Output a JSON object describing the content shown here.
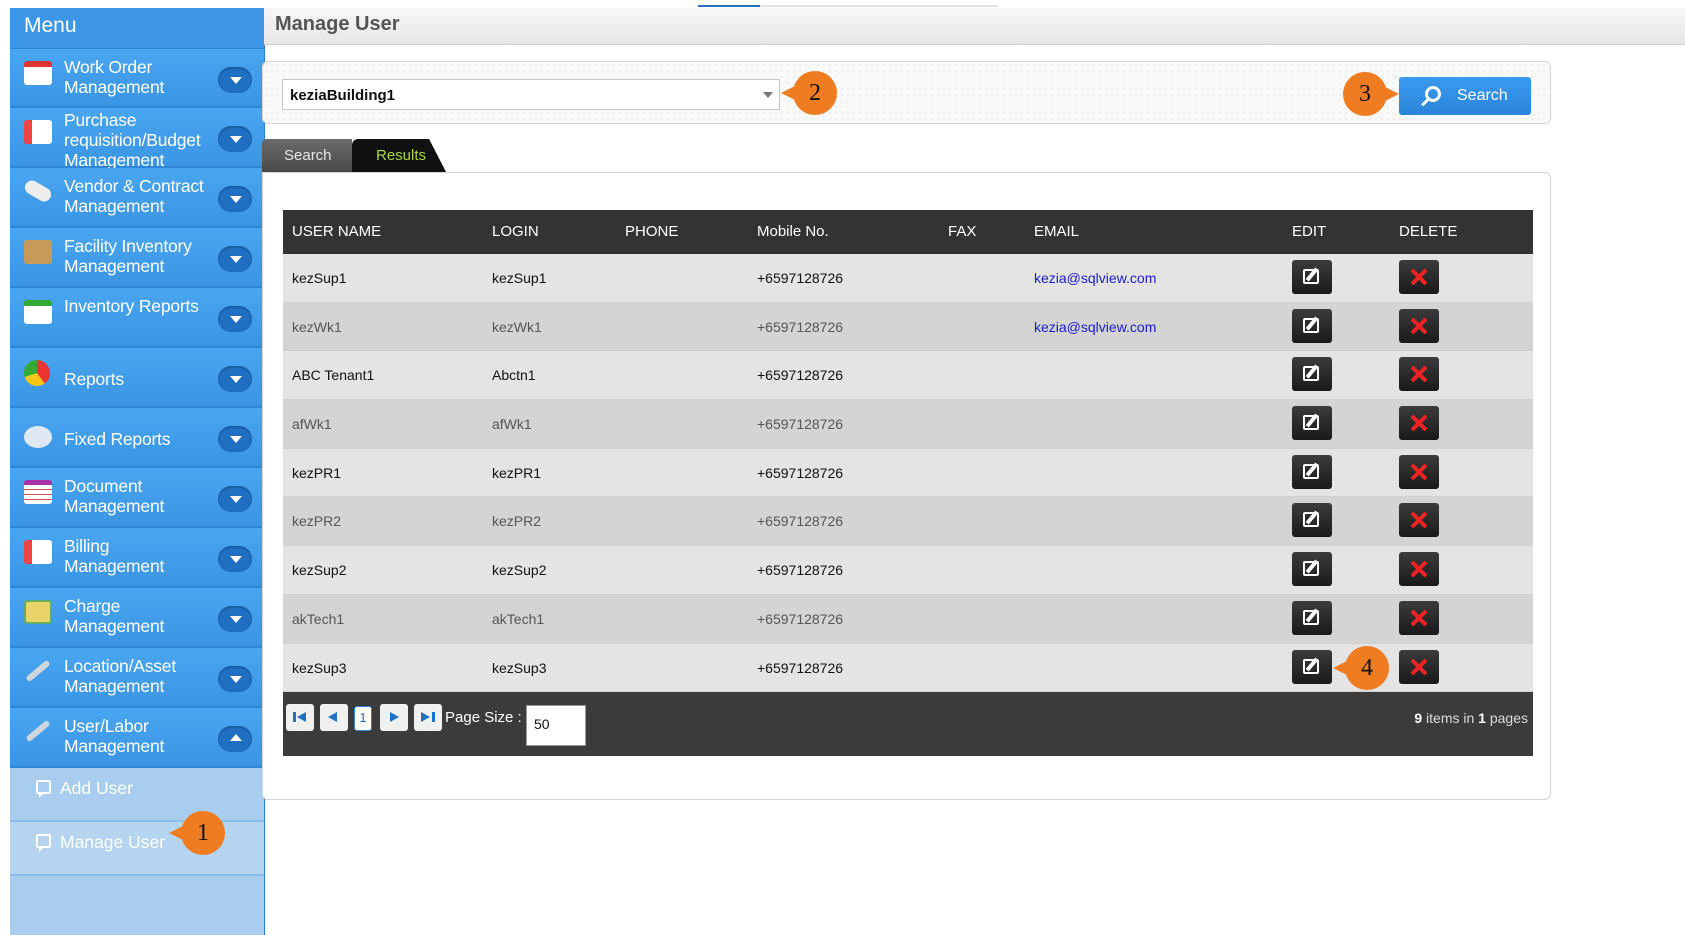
{
  "menu": {
    "title": "Menu",
    "items": [
      {
        "label": "Work Order Management",
        "icon": "calendar-icon"
      },
      {
        "label": "Purchase requisition/Budget Management",
        "icon": "document-icon"
      },
      {
        "label": "Vendor & Contract Management",
        "icon": "mouse-icon"
      },
      {
        "label": "Facility Inventory Management",
        "icon": "box-icon"
      },
      {
        "label": "Inventory Reports",
        "icon": "report-icon"
      },
      {
        "label": "Reports",
        "icon": "pie-chart-icon"
      },
      {
        "label": "Fixed Reports",
        "icon": "speech-bubble-icon"
      },
      {
        "label": "Document Management",
        "icon": "table-icon"
      },
      {
        "label": "Billing Management",
        "icon": "document-icon"
      },
      {
        "label": "Charge Management",
        "icon": "cash-icon"
      },
      {
        "label": "Location/Asset Management",
        "icon": "wrench-icon"
      },
      {
        "label": "User/Labor Management",
        "icon": "wrench-icon"
      }
    ],
    "sub_items": [
      {
        "label": "Add User"
      },
      {
        "label": "Manage User"
      }
    ]
  },
  "header": {
    "title": "Manage User"
  },
  "filter": {
    "building": "keziaBuilding1",
    "search_label": "Search"
  },
  "tabs": [
    {
      "label": "Search"
    },
    {
      "label": "Results"
    }
  ],
  "table": {
    "columns": [
      "USER NAME",
      "LOGIN",
      "PHONE",
      "Mobile No.",
      "FAX",
      "EMAIL",
      "EDIT",
      "DELETE"
    ],
    "rows": [
      {
        "username": "kezSup1",
        "login": "kezSup1",
        "phone": "",
        "mobile": "+6597128726",
        "fax": "",
        "email": "kezia@sqlview.com"
      },
      {
        "username": "kezWk1",
        "login": "kezWk1",
        "phone": "",
        "mobile": "+6597128726",
        "fax": "",
        "email": "kezia@sqlview.com"
      },
      {
        "username": "ABC Tenant1",
        "login": "Abctn1",
        "phone": "",
        "mobile": "+6597128726",
        "fax": "",
        "email": ""
      },
      {
        "username": "afWk1",
        "login": "afWk1",
        "phone": "",
        "mobile": "+6597128726",
        "fax": "",
        "email": ""
      },
      {
        "username": "kezPR1",
        "login": "kezPR1",
        "phone": "",
        "mobile": "+6597128726",
        "fax": "",
        "email": ""
      },
      {
        "username": "kezPR2",
        "login": "kezPR2",
        "phone": "",
        "mobile": "+6597128726",
        "fax": "",
        "email": ""
      },
      {
        "username": "kezSup2",
        "login": "kezSup2",
        "phone": "",
        "mobile": "+6597128726",
        "fax": "",
        "email": ""
      },
      {
        "username": "akTech1",
        "login": "akTech1",
        "phone": "",
        "mobile": "+6597128726",
        "fax": "",
        "email": ""
      },
      {
        "username": "kezSup3",
        "login": "kezSup3",
        "phone": "",
        "mobile": "+6597128726",
        "fax": "",
        "email": ""
      }
    ]
  },
  "pager": {
    "current_page": "1",
    "page_size_label": "Page Size :",
    "page_size": "50",
    "items_count": "9",
    "items_mid": " items in ",
    "pages_count": "1",
    "pages_suffix": " pages"
  },
  "callouts": [
    "1",
    "2",
    "3",
    "4"
  ],
  "colors": {
    "sidebar": "#3f9ae6",
    "accent_button": "#2a85da",
    "callout": "#f07c22",
    "header_row": "#333333",
    "results_tab_text": "#a8d83a"
  }
}
